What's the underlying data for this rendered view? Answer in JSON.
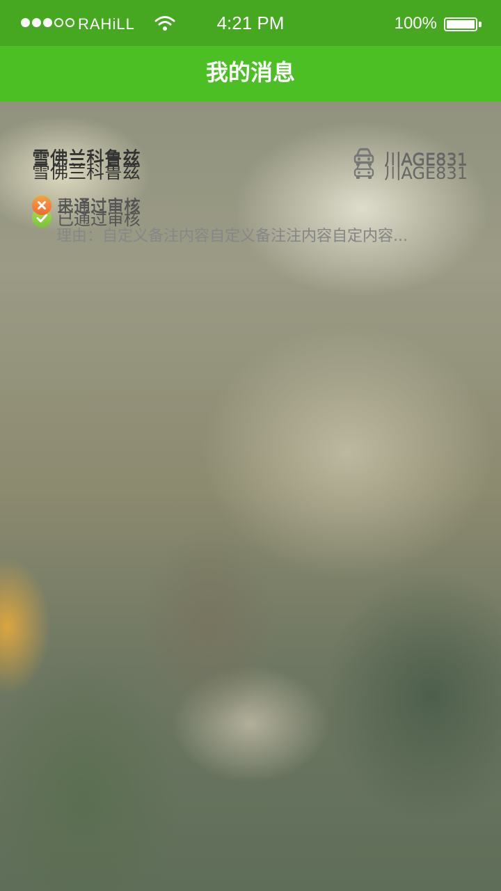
{
  "status_bar": {
    "carrier": "RAHiLL",
    "time": "4:21 PM",
    "battery": "100%"
  },
  "header": {
    "title": "我的消息"
  },
  "messages": [
    {
      "car_name": "雪佛兰科鲁兹",
      "plate": "川AGE831",
      "status": "已通过审核",
      "status_type": "approved",
      "reason": ""
    },
    {
      "car_name": "雪佛兰科鲁兹",
      "plate": "川AGE831",
      "status": "未通过审核",
      "status_type": "rejected",
      "reason": "理由：自定义备注内容自定义备注注内容自定内容..."
    },
    {
      "car_name": "雪佛兰科鲁兹",
      "plate": "川AGE831",
      "status": "已通过审核",
      "status_type": "approved",
      "reason": ""
    },
    {
      "car_name": "雪佛兰科鲁兹",
      "plate": "川AGE831",
      "status": "未通过审核",
      "status_type": "rejected",
      "reason": "理由：自定义备注内容自定义备注注内容自定内容..."
    }
  ],
  "icons": {
    "car": "car-icon",
    "approved": "check-circle-icon",
    "rejected": "x-circle-icon"
  },
  "colors": {
    "status_bar": "#46a720",
    "nav_bar": "#4cbf24",
    "approved": "#8fd245",
    "rejected": "#f07d36"
  }
}
